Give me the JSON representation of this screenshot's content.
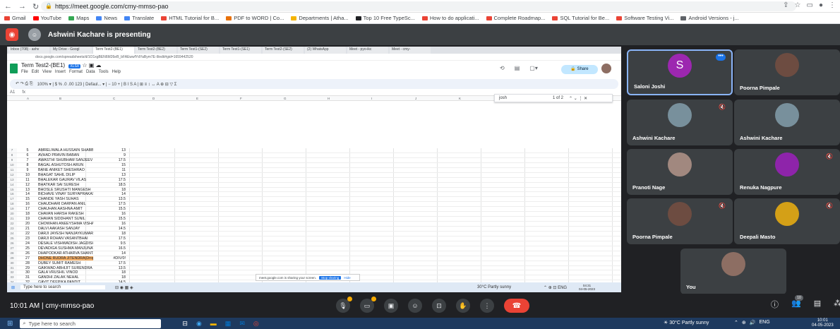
{
  "browser": {
    "url": "https://meet.google.com/cmy-mmso-pao"
  },
  "bookmarks": [
    {
      "label": "Gmail",
      "color": "#ea4335"
    },
    {
      "label": "YouTube",
      "color": "#ff0000"
    },
    {
      "label": "Maps",
      "color": "#34a853"
    },
    {
      "label": "News",
      "color": "#4285f4"
    },
    {
      "label": "Translate",
      "color": "#4285f4"
    },
    {
      "label": "HTML Tutorial for B...",
      "color": "#ea4335"
    },
    {
      "label": "PDF to WORD | Co...",
      "color": "#e8710a"
    },
    {
      "label": "Departments | Atha...",
      "color": "#f4b400"
    },
    {
      "label": "Top 10 Free TypeSc...",
      "color": "#202124"
    },
    {
      "label": "How to do applicati...",
      "color": "#ea4335"
    },
    {
      "label": "Complete Roadmap...",
      "color": "#ea4335"
    },
    {
      "label": "SQL Tutorial for Be...",
      "color": "#ea4335"
    },
    {
      "label": "Software Testing Vi...",
      "color": "#ea4335"
    },
    {
      "label": "Android Versions - j...",
      "color": "#5f6368"
    }
  ],
  "presenter": {
    "text": "Ashwini Kacharе is presenting"
  },
  "shared": {
    "tabs": [
      "Inbox (708) - ashv",
      "My Drive - Googl",
      "Term Test2-(BE1)",
      "Term Test2-(BE2)",
      "Term Test1-(SE2)",
      "Term Test1-(SE1)",
      "Term Test2-(SE2)",
      "(2) WhatsApp",
      "Meet - pyo-ikc",
      "Meet - cmy-"
    ],
    "url": "docs.google.com/spreadsheets/d/1O1xgBEN6M26eB_bFAEwwfYdYaBym7E-ll/edit#gid=1659442520",
    "doc_title": "Term Test2-(BE1)",
    "doc_badge": "XLSX",
    "menu": [
      "File",
      "Edit",
      "View",
      "Insert",
      "Format",
      "Data",
      "Tools",
      "Help"
    ],
    "share_label": "Share",
    "toolbar": "100%  ▾  |  $  %  .0  .00  123  |  Defaul...  ▾  |  −  10  +  |  B  I  S  A  |  ⊞  ≡  ↕  ↔  A  ⊕  ⊟  ▽  Σ",
    "cell_ref": "A1",
    "fx": "fx",
    "col_headers": [
      "A",
      "B",
      "C",
      "D",
      "E",
      "F",
      "G",
      "H",
      "I",
      "J",
      "K",
      "L",
      "M",
      "N",
      "O",
      "P"
    ],
    "find": {
      "query": "josh",
      "count": "1 of 2"
    },
    "rows": [
      {
        "rn": "7",
        "a": "5",
        "b": "AMRELIWALA HUSSAIN SHABBIR",
        "c": "13"
      },
      {
        "rn": "8",
        "a": "6",
        "b": "AVHAD PRAVIN BABAN",
        "c": "9"
      },
      {
        "rn": "9",
        "a": "7",
        "b": "AWASTHI SHUBHAM SANJEEV",
        "c": "17.5"
      },
      {
        "rn": "10",
        "a": "8",
        "b": "BAGAL ASHUTOSH ARUN",
        "c": "15"
      },
      {
        "rn": "11",
        "a": "9",
        "b": "BANE ANIKET SHESHRAO",
        "c": "11"
      },
      {
        "rn": "12",
        "a": "10",
        "b": "BHAGAT SAHIL DILIP",
        "c": "13"
      },
      {
        "rn": "13",
        "a": "11",
        "b": "BHALEKAR GAURAV VILAS",
        "c": "17.5"
      },
      {
        "rn": "14",
        "a": "12",
        "b": "BHATKAR SAI SURESH",
        "c": "18.5"
      },
      {
        "rn": "15",
        "a": "13",
        "b": "BHOSLE SRUSHTI MANGESH",
        "c": "18"
      },
      {
        "rn": "16",
        "a": "14",
        "b": "BICHAVE VINAY SURYAPRAKASH",
        "c": "14"
      },
      {
        "rn": "17",
        "a": "15",
        "b": "CHANDE YASH SUHAS",
        "c": "13.5"
      },
      {
        "rn": "18",
        "a": "16",
        "b": "CHAUDHARI DARPAN ANIL",
        "c": "17.5"
      },
      {
        "rn": "19",
        "a": "17",
        "b": "CHAUHAN AASHNA AMIT",
        "c": "15.5"
      },
      {
        "rn": "20",
        "a": "18",
        "b": "CHAVAN HARSH RAKESH",
        "c": "16"
      },
      {
        "rn": "21",
        "a": "19",
        "b": "CHAVAN SIDDHANT SUNIL",
        "c": "15.5"
      },
      {
        "rn": "22",
        "a": "20",
        "b": "CHOWHAN ANEEYSHMA VISHAL",
        "c": "16"
      },
      {
        "rn": "23",
        "a": "21",
        "b": "DALVI AAKASH SANJAY",
        "c": "14.5"
      },
      {
        "rn": "24",
        "a": "22",
        "b": "DARJI JAYESH NANJAYKUMAR",
        "c": "18"
      },
      {
        "rn": "25",
        "a": "23",
        "b": "DARJI ROHAN VASANTBHAI",
        "c": "17.5"
      },
      {
        "rn": "26",
        "a": "24",
        "b": "DESALE VISHWADISH JAGDISH",
        "c": "9.5"
      },
      {
        "rn": "27",
        "a": "25",
        "b": "DEVADIGA SUSHMA MANJUNATH",
        "c": "16.5"
      },
      {
        "rn": "28",
        "a": "26",
        "b": "DHAPODKAR ATHARVA SHANTARAM",
        "c": "14"
      },
      {
        "rn": "29",
        "a": "27",
        "b": "DHONE RUDRA JITENDRA(Drop)",
        "c": "#DIV/0!",
        "hl": true
      },
      {
        "rn": "30",
        "a": "28",
        "b": "DUBEY SUMIT RAMESH",
        "c": "17.5"
      },
      {
        "rn": "31",
        "a": "29",
        "b": "GAIKWAD ABHIJIT SURENDRA",
        "c": "13.5"
      },
      {
        "rn": "32",
        "a": "30",
        "b": "GALA VRUSHIL VINOD",
        "c": "18"
      },
      {
        "rn": "33",
        "a": "31",
        "b": "GANDHI ZALAK NEHAL",
        "c": "18"
      },
      {
        "rn": "34",
        "a": "32",
        "b": "GAVIT DEEPIKA PANDIT",
        "c": "14.5"
      }
    ],
    "sheet_tabs": [
      "ERP-PM",
      "PM-DM",
      "Block chain-PP",
      "B&DLT_AVERAGE",
      "BDA-RN"
    ],
    "active_sheet": "B&DLT_AVERAGE",
    "share_notice": {
      "text": "meet.google.com is sharing your screen.",
      "stop": "Stop sharing",
      "hide": "Hide"
    },
    "inner_search": "Type here to search",
    "inner_weather": "30°C  Partly sunny",
    "inner_clock": {
      "time": "04:31",
      "date": "04-05-2023"
    }
  },
  "participants": [
    {
      "name": "Saloni Joshi",
      "initial": "S",
      "color": "#9c27b0",
      "muted": false
    },
    {
      "name": "Poorna Pimpale",
      "color": "#6d4c41",
      "muted": false
    },
    {
      "name": "Ashwini Kacharе",
      "color": "#78909c",
      "muted": true
    },
    {
      "name": "Ashwini Kacharе",
      "color": "#78909c",
      "muted": false
    },
    {
      "name": "Pranoti Nage",
      "color": "#a1887f",
      "muted": false
    },
    {
      "name": "Renuka Nagpure",
      "color": "#8e24aa",
      "muted": true
    },
    {
      "name": "Poorna Pimpale",
      "color": "#6d4c41",
      "muted": true
    },
    {
      "name": "Deepali Masto",
      "color": "#d4a017",
      "muted": true
    },
    {
      "name": "You",
      "color": "#8d6e63",
      "muted": false
    }
  ],
  "meet_bar": {
    "time_code": "10:01 AM  |  cmy-mmso-pao",
    "people_count": "10"
  },
  "taskbar": {
    "search": "Type here to search",
    "weather": "30°C  Partly sunny",
    "tray": "ENG",
    "time": "10:01",
    "date": "04-05-2023"
  }
}
